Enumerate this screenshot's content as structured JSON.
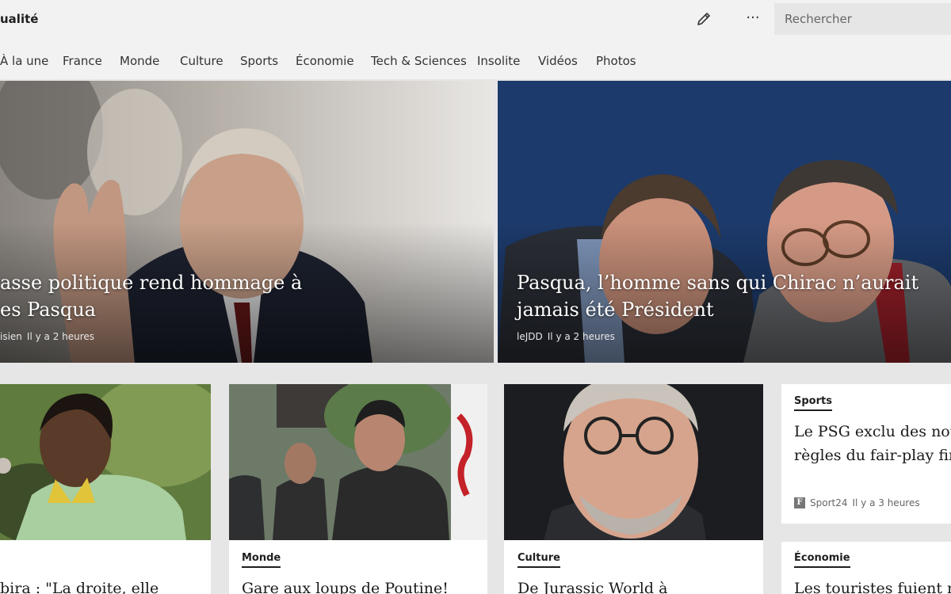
{
  "app": {
    "title": "ualité"
  },
  "toolbar": {
    "edit_icon": "pencil-icon",
    "more_label": "···",
    "search_placeholder": "Rechercher"
  },
  "nav": {
    "items": [
      {
        "label": "À la une"
      },
      {
        "label": "France"
      },
      {
        "label": "Monde"
      },
      {
        "label": "Culture"
      },
      {
        "label": "Sports"
      },
      {
        "label": "Économie"
      },
      {
        "label": "Tech & Sciences"
      },
      {
        "label": "Insolite"
      },
      {
        "label": "Vidéos"
      },
      {
        "label": "Photos"
      }
    ]
  },
  "hero": [
    {
      "title_line1": "asse politique rend hommage à",
      "title_line2": "es Pasqua",
      "source": "isien",
      "time": "Il y a 2 heures"
    },
    {
      "title_line1": "Pasqua, l’homme sans qui Chirac n’aurait",
      "title_line2": "jamais été Président",
      "source": "leJDD",
      "time": "Il y a 2 heures"
    }
  ],
  "cards": [
    {
      "category": "",
      "title": "bira : \"La droite, elle"
    },
    {
      "category": "Monde",
      "title": "Gare aux loups de Poutine!"
    },
    {
      "category": "Culture",
      "title": "De Jurassic World à"
    },
    {
      "category": "Sports",
      "title_line1": "Le PSG exclu des nou",
      "title_line2": "règles du fair-play fin",
      "source": "Sport24",
      "source_logo": "F",
      "time": "Il y a 3 heures"
    },
    {
      "category": "Économie",
      "title": "Les touristes fuient m"
    }
  ],
  "colors": {
    "topbar": "#f2f2f2",
    "page_bg": "#e6e6e6",
    "text": "#1f1f1f"
  }
}
